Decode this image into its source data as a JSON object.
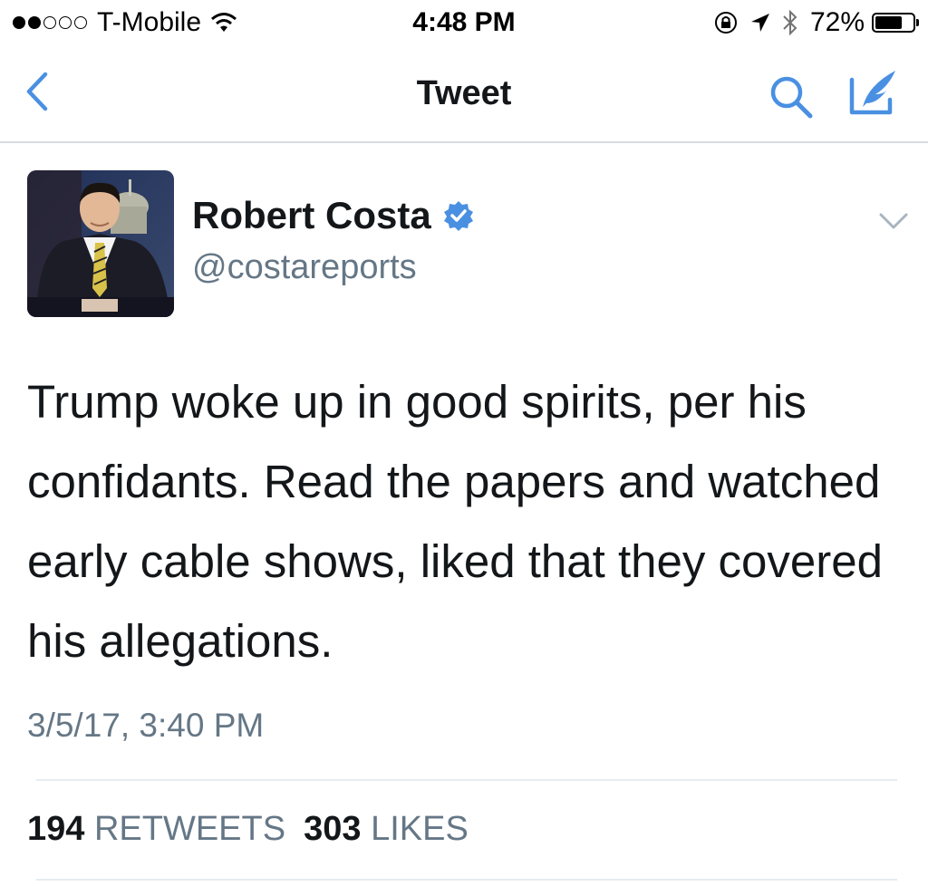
{
  "status_bar": {
    "carrier": "T-Mobile",
    "time": "4:48 PM",
    "battery": "72%",
    "battery_level": 0.72,
    "signal_bars": 2,
    "signal_total": 5
  },
  "nav": {
    "title": "Tweet",
    "accent_color": "#4a90e2",
    "icons": [
      "back-chevron-icon",
      "search-icon",
      "compose-tweet-icon"
    ]
  },
  "tweet": {
    "author_name": "Robert Costa",
    "handle": "@costareports",
    "verified": true,
    "text": "Trump woke up in good spirits, per his confidants. Read the papers and watched early cable shows, liked that they covered his allegations.",
    "timestamp": "3/5/17, 3:40 PM",
    "retweet_count": "194",
    "retweets_label": "RETWEETS",
    "like_count": "303",
    "likes_label": "LIKES"
  }
}
